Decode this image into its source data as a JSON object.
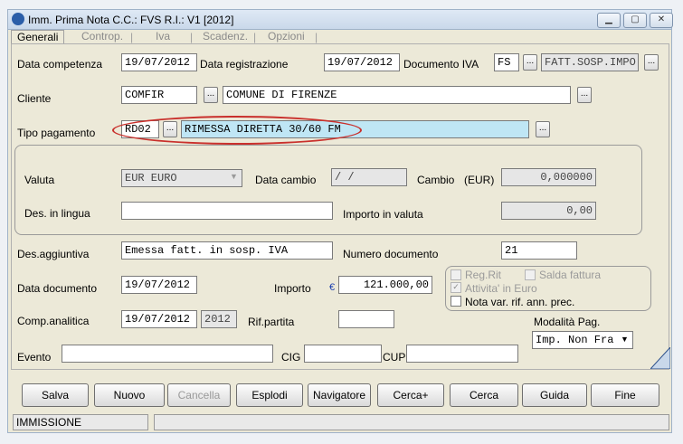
{
  "window": {
    "title": "Imm. Prima Nota C.C.: FVS  R.I.: V1  [2012]"
  },
  "tabs": [
    {
      "label": "Generali"
    },
    {
      "label": "Controp."
    },
    {
      "label": "Iva"
    },
    {
      "label": "Scadenz."
    },
    {
      "label": "Opzioni"
    }
  ],
  "form": {
    "data_competenza_label": "Data competenza",
    "data_competenza": "19/07/2012",
    "data_registrazione_label": "Data registrazione",
    "data_registrazione": "19/07/2012",
    "documento_iva_label": "Documento IVA",
    "documento_iva_code": "FS",
    "documento_iva_desc": "FATT.SOSP.IMPO",
    "cliente_label": "Cliente",
    "cliente_code": "COMFIR",
    "cliente_desc": "COMUNE DI FIRENZE",
    "tipo_pagamento_label": "Tipo pagamento",
    "tipo_pagamento_code": "RD02",
    "tipo_pagamento_desc": "RIMESSA DIRETTA 30/60 FM",
    "valuta_label": "Valuta",
    "valuta_value": "EUR EURO",
    "data_cambio_label": "Data cambio",
    "data_cambio": " /  /",
    "cambio_label": "Cambio",
    "cambio_unit": "(EUR)",
    "cambio_value": "0,000000",
    "des_lingua_label": "Des. in lingua",
    "des_lingua_value": "",
    "importo_valuta_label": "Importo in valuta",
    "importo_valuta": "0,00",
    "des_aggiuntiva_label": "Des.aggiuntiva",
    "des_aggiuntiva": "Emessa fatt. in sosp. IVA",
    "numero_documento_label": "Numero documento",
    "numero_documento": "21",
    "data_documento_label": "Data documento",
    "data_documento": "19/07/2012",
    "importo_label": "Importo",
    "importo_currency": "€",
    "importo": "121.000,00",
    "reg_rit_label": "Reg.Rit",
    "salda_fattura_label": "Salda fattura",
    "attivita_euro_label": "Attivita' in Euro",
    "nota_var_label": "Nota var. rif. ann. prec.",
    "comp_analitica_label": "Comp.analitica",
    "comp_analitica": "19/07/2012",
    "comp_analitica_year": "2012",
    "rif_partita_label": "Rif.partita",
    "rif_partita": "",
    "modalita_pag_label": "Modalità Pag.",
    "modalita_pag_value": "Imp. Non Fra",
    "evento_label": "Evento",
    "evento": "",
    "cig_label": "CIG",
    "cig": "",
    "cup_label": "CUP",
    "cup": ""
  },
  "buttons": {
    "salva": "Salva",
    "nuovo": "Nuovo",
    "cancella": "Cancella",
    "esplodi": "Esplodi",
    "navigatore": "Navigatore",
    "cerca_plus": "Cerca+",
    "cerca": "Cerca",
    "guida": "Guida",
    "fine": "Fine",
    "lookup": "..."
  },
  "status": {
    "mode": "IMMISSIONE",
    "message": ""
  },
  "colors": {
    "highlight_field": "#bfe6f5",
    "annotation_ellipse": "#c9302c",
    "currency_symbol": "#1a3fb0"
  }
}
